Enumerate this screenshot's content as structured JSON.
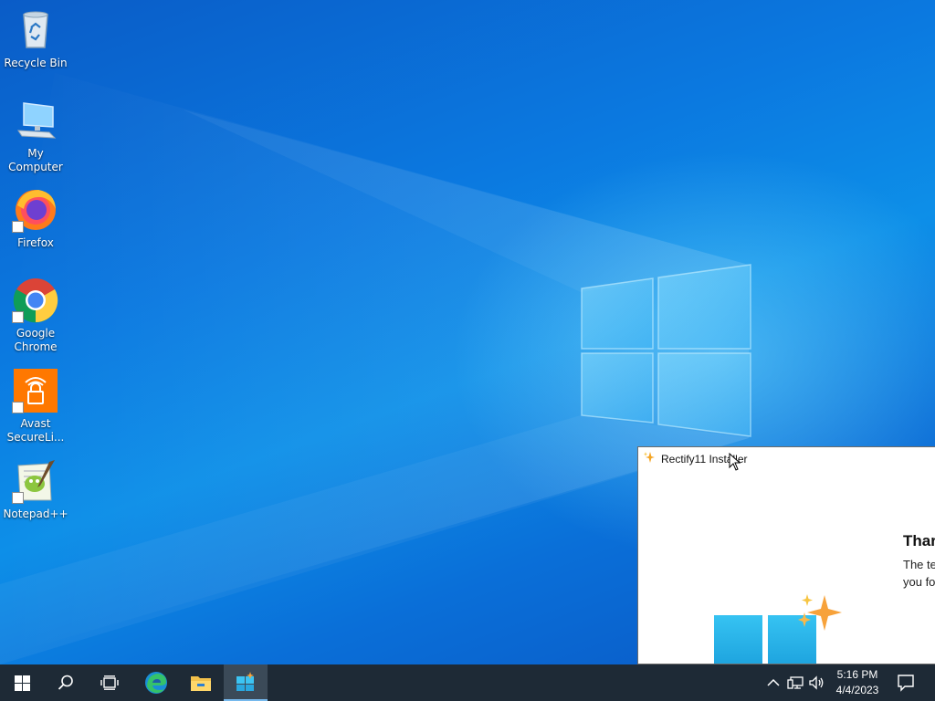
{
  "desktop": {
    "icons": [
      {
        "label": "Recycle Bin",
        "icon": "recycle-bin-icon"
      },
      {
        "label": "My Computer",
        "icon": "computer-icon"
      },
      {
        "label": "Firefox",
        "icon": "firefox-icon"
      },
      {
        "label": "Google Chrome",
        "icon": "chrome-icon"
      },
      {
        "label": "Avast SecureLi...",
        "icon": "avast-secureline-icon"
      },
      {
        "label": "Notepad++",
        "icon": "notepad-plus-plus-icon"
      }
    ]
  },
  "installer": {
    "title": "Rectify11 Installer",
    "heading": "Thar",
    "body_line1": "The te",
    "body_line2": "you fo"
  },
  "taskbar": {
    "buttons": [
      "start-icon",
      "search-icon",
      "task-view-icon",
      "edge-icon",
      "file-explorer-icon",
      "rectify11-installer-icon"
    ],
    "clock_time": "5:16 PM",
    "clock_date": "4/4/2023",
    "tray": [
      "chevron-up-icon",
      "network-icon",
      "volume-icon",
      "notification-icon"
    ]
  },
  "colors": {
    "taskbar_bg": "#1e2a36",
    "accent": "#76b9ed",
    "wallpaper_base": "#0a6fd6"
  }
}
